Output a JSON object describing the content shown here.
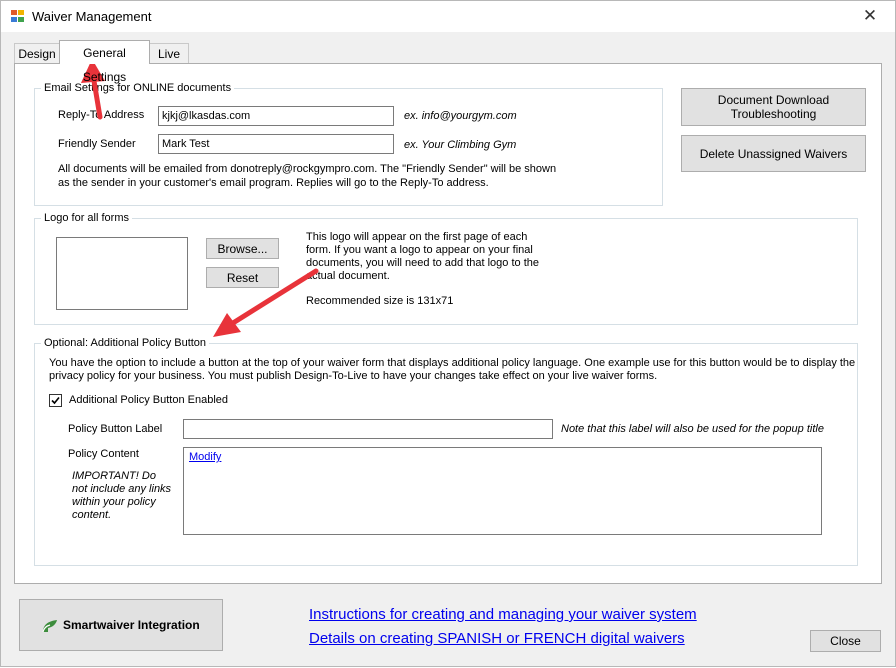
{
  "window": {
    "title": "Waiver Management",
    "close_glyph": "✕"
  },
  "tabs": [
    {
      "label": "Design"
    },
    {
      "label": "General Settings",
      "active": true
    },
    {
      "label": "Live"
    }
  ],
  "email_group": {
    "legend": "Email Settings for ONLINE  documents",
    "reply_to_label": "Reply-To Address",
    "reply_to_value": "kjkj@lkasdas.com",
    "reply_to_example": "ex.  info@yourgym.com",
    "sender_label": "Friendly Sender",
    "sender_value": "Mark Test",
    "sender_example": "ex.  Your Climbing Gym",
    "note_line1": "All documents will be emailed from donotreply@rockgympro.com.  The \"Friendly Sender\" will be shown",
    "note_line2": "as the sender in your customer's email program.  Replies will go to the Reply-To address."
  },
  "right_buttons": {
    "download_line1": "Document Download",
    "download_line2": "Troubleshooting",
    "delete_unassigned": "Delete Unassigned Waivers"
  },
  "logo_group": {
    "legend": "Logo for all forms",
    "browse_label": "Browse...",
    "reset_label": "Reset",
    "desc_line1": "This logo will appear on the first page of each",
    "desc_line2": "form.  If you want a logo to appear on your final",
    "desc_line3": "documents, you will need to add that logo to the",
    "desc_line4": "actual document.",
    "recommended": "Recommended size is 131x71"
  },
  "policy_group": {
    "legend": "Optional: Additional Policy Button",
    "desc_line1": "You have the option to include a button at the top of your waiver form that displays additional policy language. One example use for this button would be to display the",
    "desc_line2": "privacy policy for your business. You must publish Design-To-Live to have your changes take effect on your live waiver forms.",
    "checkbox_label": "Additional Policy Button Enabled",
    "checkbox_checked": true,
    "button_label_label": "Policy Button Label",
    "button_label_value": "",
    "button_label_note": "Note that this label will also be used for the popup title",
    "content_label": "Policy Content",
    "important_line1": "IMPORTANT!  Do",
    "important_line2": "not include any links",
    "important_line3": "within your policy",
    "important_line4": "content.",
    "modify_link": "Modify"
  },
  "footer": {
    "smartwaiver_label": "Smartwaiver Integration",
    "link_instructions": "Instructions for creating and managing your waiver system",
    "link_spanish_french": "Details on creating SPANISH or FRENCH digital waivers",
    "close_label": "Close"
  },
  "colors": {
    "annotation_arrow": "#e8333a",
    "link": "#0000ee",
    "smartwaiver_green": "#3c8c3c"
  }
}
